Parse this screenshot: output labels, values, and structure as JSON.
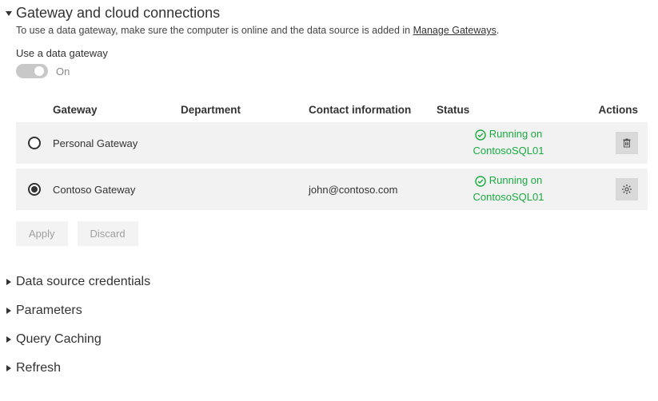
{
  "main_section": {
    "title": "Gateway and cloud connections",
    "help_prefix": "To use a data gateway, make sure the computer is online and the data source is added in ",
    "help_link": "Manage Gateways",
    "help_suffix": ".",
    "toggle_label": "Use a data gateway",
    "toggle_state": "On"
  },
  "table": {
    "headers": {
      "gateway": "Gateway",
      "department": "Department",
      "contact": "Contact information",
      "status": "Status",
      "actions": "Actions"
    },
    "rows": [
      {
        "selected": false,
        "gateway": "Personal Gateway",
        "department": "",
        "contact": "",
        "status_line1": "Running on",
        "status_line2": "ContosoSQL01",
        "action_icon": "trash"
      },
      {
        "selected": true,
        "gateway": "Contoso Gateway",
        "department": "",
        "contact": "john@contoso.com",
        "status_line1": "Running on",
        "status_line2": "ContosoSQL01",
        "action_icon": "gear"
      }
    ]
  },
  "buttons": {
    "apply": "Apply",
    "discard": "Discard"
  },
  "sections": [
    "Data source credentials",
    "Parameters",
    "Query Caching",
    "Refresh"
  ]
}
